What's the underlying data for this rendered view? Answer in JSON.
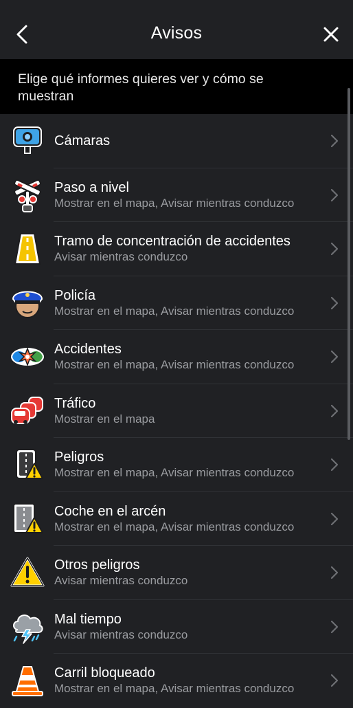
{
  "header": {
    "title": "Avisos"
  },
  "subtitle": "Elige qué informes quieres ver y cómo se muestran",
  "items": [
    {
      "label": "Cámaras",
      "sub": "",
      "icon": "speed-camera-icon"
    },
    {
      "label": "Paso a nivel",
      "sub": "Mostrar en el mapa, Avisar mientras conduzco",
      "icon": "railroad-crossing-icon"
    },
    {
      "label": "Tramo de concentración de accidentes",
      "sub": "Avisar mientras conduzco",
      "icon": "accident-road-icon"
    },
    {
      "label": "Policía",
      "sub": "Mostrar en el mapa, Avisar mientras conduzco",
      "icon": "police-icon"
    },
    {
      "label": "Accidentes",
      "sub": "Mostrar en el mapa, Avisar mientras conduzco",
      "icon": "crash-icon"
    },
    {
      "label": "Tráfico",
      "sub": "Mostrar en el mapa",
      "icon": "traffic-icon"
    },
    {
      "label": "Peligros",
      "sub": "Mostrar en el mapa, Avisar mientras conduzco",
      "icon": "hazard-icon"
    },
    {
      "label": "Coche en el arcén",
      "sub": "Mostrar en el mapa, Avisar mientras conduzco",
      "icon": "car-on-shoulder-icon"
    },
    {
      "label": "Otros peligros",
      "sub": "Avisar mientras conduzco",
      "icon": "warning-icon"
    },
    {
      "label": "Mal tiempo",
      "sub": "Avisar mientras conduzco",
      "icon": "storm-cloud-icon"
    },
    {
      "label": "Carril bloqueado",
      "sub": "Mostrar en el mapa, Avisar mientras conduzco",
      "icon": "traffic-cone-icon"
    }
  ]
}
